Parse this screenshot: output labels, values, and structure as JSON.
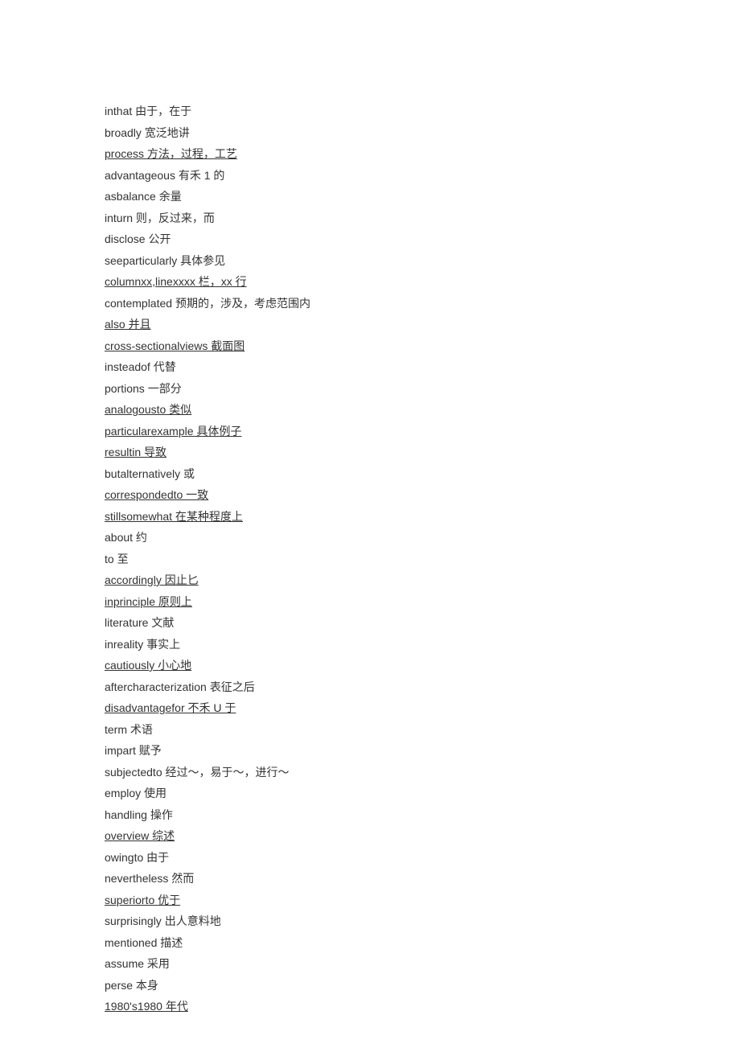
{
  "entries": [
    {
      "text": "inthat 由于，在于",
      "u": false
    },
    {
      "text": "broadly 宽泛地讲",
      "u": false
    },
    {
      "text": "process 方法，过程，工艺",
      "u": true,
      "cls": "long-a"
    },
    {
      "text": "advantageous 有禾 1 的",
      "u": false
    },
    {
      "text": "asbalance 余量",
      "u": false
    },
    {
      "text": "inturn 则，反过来，而",
      "u": false
    },
    {
      "text": "disclose 公开",
      "u": false
    },
    {
      "text": "seeparticularly 具体参见",
      "u": false
    },
    {
      "text": "columnxx,linexxxx 栏，xx 行",
      "u": true,
      "cls": "long-a"
    },
    {
      "text": "contemplated 预期的，涉及，考虑范围内",
      "u": false
    },
    {
      "text": "also 并且",
      "u": true
    },
    {
      "text": "cross-sectionalviews 截面图",
      "u": true
    },
    {
      "text": "insteadof 代替",
      "u": false
    },
    {
      "text": "portions 一部分",
      "u": false
    },
    {
      "text": "analogousto 类似",
      "u": true,
      "cls": "long-b"
    },
    {
      "text": "particularexample 具体例子",
      "u": true
    },
    {
      "text": "resultin 导致",
      "u": true
    },
    {
      "text": "butalternatively 或",
      "u": false
    },
    {
      "text": "correspondedto 一致",
      "u": true,
      "cls": "long-f"
    },
    {
      "text": "stillsomewhat 在某种程度上",
      "u": true
    },
    {
      "text": "about 约",
      "u": false
    },
    {
      "text": "to 至",
      "u": false
    },
    {
      "text": "accordingly 因止匕",
      "u": true,
      "cls": "long-b"
    },
    {
      "text": "inprinciple 原则上",
      "u": true
    },
    {
      "text": "literature 文献",
      "u": false
    },
    {
      "text": "inreality 事实上",
      "u": false
    },
    {
      "text": "cautiously 小心地",
      "u": true
    },
    {
      "text": "aftercharacterization 表征之后",
      "u": false
    },
    {
      "text": "disadvantagefor 不禾 U 于",
      "u": true
    },
    {
      "text": "term 术语",
      "u": false
    },
    {
      "text": "impart 赋予",
      "u": false
    },
    {
      "text": "subjectedto 经过〜，易于〜，进行〜",
      "u": false
    },
    {
      "text": "employ 使用",
      "u": false
    },
    {
      "text": "handling 操作",
      "u": false
    },
    {
      "text": "overview 综述",
      "u": true
    },
    {
      "text": "owingto 由于",
      "u": false
    },
    {
      "text": "nevertheless 然而",
      "u": false
    },
    {
      "text": "superiorto 优于",
      "u": true
    },
    {
      "text": "surprisingly 出人意料地",
      "u": false
    },
    {
      "text": "mentioned 描述",
      "u": false
    },
    {
      "text": "assume 采用",
      "u": false
    },
    {
      "text": "perse 本身",
      "u": false
    },
    {
      "text": "1980's1980 年代",
      "u": true
    }
  ]
}
